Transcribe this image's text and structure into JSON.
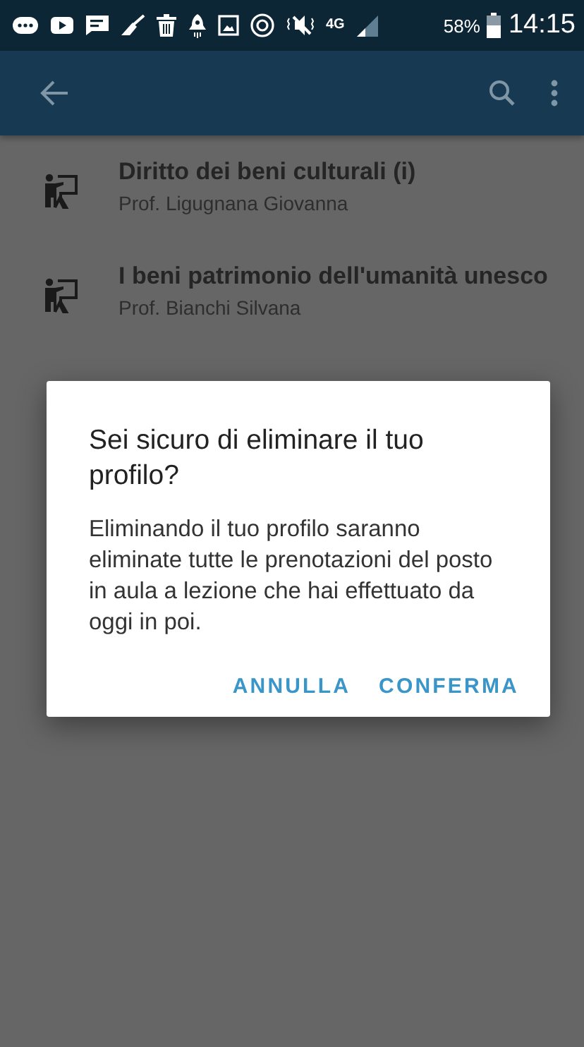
{
  "status_bar": {
    "network": "4G",
    "battery": "58%",
    "time": "14:15"
  },
  "courses": [
    {
      "title": "Diritto dei beni culturali (i)",
      "teacher": "Prof. Ligugnana Giovanna"
    },
    {
      "title": "I beni patrimonio dell'umanità unesco",
      "teacher": "Prof. Bianchi Silvana"
    }
  ],
  "dialog": {
    "title": "Sei sicuro di eliminare il tuo profilo?",
    "message": "Eliminando il tuo profilo saranno eliminate tutte le prenotazioni del posto in aula a lezione che hai effettuato da oggi in poi.",
    "buttons": [
      "ANNULLA",
      "CONFERMA"
    ]
  }
}
